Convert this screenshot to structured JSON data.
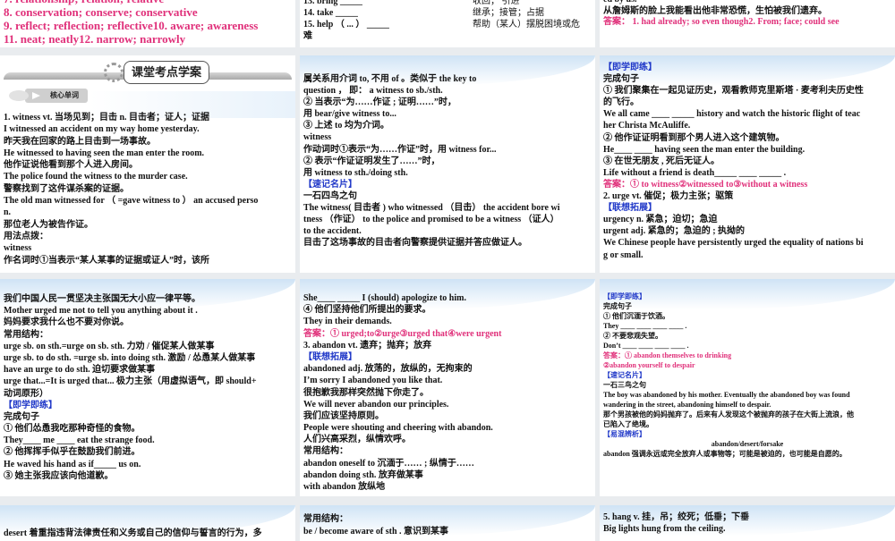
{
  "slides": [
    {
      "id": "top-left",
      "lines": [
        {
          "t": "7. relationship; relation; relative",
          "c": "pink"
        },
        {
          "t": "8. conservation; conserve; conservative",
          "c": "pink"
        },
        {
          "t": "9. reflect; reflection; reflective10. aware; awareness",
          "c": "pink"
        },
        {
          "t": "11. neat; neatly12. narrow; narrowly",
          "c": "pink"
        }
      ]
    },
    {
      "id": "top-middle",
      "lines": [
        {
          "t": "13. bring _____"
        },
        {
          "t": "14. take _____"
        },
        {
          "t": "15. help （ ... ）    _____"
        },
        {
          "t": "难"
        }
      ],
      "right_lines": [
        {
          "t": "收回；  引进"
        },
        {
          "t": "继承；接管；占据"
        },
        {
          "t": " 帮助（某人）摆脱困境或危"
        }
      ]
    },
    {
      "id": "top-right",
      "lines": [
        {
          "t": "ed by us."
        },
        {
          "t": "从詹姆斯的脸上我能看出他非常恐慌，生怕被我们遗弃。"
        },
        {
          "t": "答案： 1. had already; so even though2. From; face; could see",
          "c": "pink"
        }
      ]
    },
    {
      "id": "witness-core",
      "banner": "课堂考点学案",
      "tag": "核心单词",
      "lines": [
        {
          "t": "1. witness vt. 当场见到；目击 n. 目击者；证人；证据"
        },
        {
          "t": "I witnessed an accident on my way home yesterday."
        },
        {
          "t": "昨天我在回家的路上目击到一场事故。"
        },
        {
          "t": "He witnessed to having seen the man enter the room."
        },
        {
          "t": "他作证说他看到那个人进入房间。"
        },
        {
          "t": "The police found the witness to the murder case."
        },
        {
          "t": "警察找到了这件谋杀案的证据。"
        },
        {
          "t": "The old man  witnessed for （ =gave witness to ）   an accused perso"
        },
        {
          "t": "n."
        },
        {
          "t": "那位老人为被告作证。"
        },
        {
          "t": "用法点拨："
        },
        {
          "t": "witness"
        },
        {
          "t": "作名词时①当表示“某人某事的证据或证人”时，该所"
        }
      ]
    },
    {
      "id": "witness-usage",
      "lines": [
        {
          "t": "属关系用介词 to, 不用 of  。类似于 the key to"
        },
        {
          "t": "question ， 即：  a witness to sb./sth."
        },
        {
          "t": "② 当表示“为……作证 ; 证明……”时，"
        },
        {
          "t": "用 bear/give witness to..."
        },
        {
          "t": "③ 上述 to 均为介词。"
        },
        {
          "t": "witness"
        },
        {
          "t": "作动词时①表示“为……作证”时，用 witness for..."
        },
        {
          "t": "② 表示“作证证明发生了……”时，"
        },
        {
          "t": "用 witness to sth./doing sth."
        },
        {
          "t": "【速记名片】",
          "c": "blue"
        },
        {
          "t": "一石四鸟之句"
        },
        {
          "t": "The witness( 目击者 ) who witnessed （目击）   the accident bore wi"
        },
        {
          "t": "tness （作证）   to the police and promised to be a witness （证人）"
        },
        {
          "t": "to the accident."
        },
        {
          "t": "目击了这场事故的目击者向警察提供证据并答应做证人。"
        }
      ]
    },
    {
      "id": "witness-practice",
      "lines": [
        {
          "t": "【即学即练】",
          "c": "blue"
        },
        {
          "t": "完成句子"
        },
        {
          "t": "① 我们聚集在一起见证历史，观看教师克里斯塔 · 麦考利夫历史性"
        },
        {
          "t": "的飞行。"
        },
        {
          "t": "We all came ____ _____  history and watch the historic flight of teac"
        },
        {
          "t": "her Christa McAuliffe."
        },
        {
          "t": "② 他作证证明看到那个男人进入这个建筑物。"
        },
        {
          "t": "He____ ____  having seen the man enter the building."
        },
        {
          "t": "③ 在世无朋友 , 死后无证人。"
        },
        {
          "t": "Life without a friend is death_____ ____ _____ ."
        },
        {
          "t": "答案：① to witness②witnessed to③without a witness",
          "c": "pink"
        },
        {
          "t": "2. urge vt.  催促；极力主张；驱策"
        },
        {
          "t": "【联想拓展】",
          "c": "blue"
        },
        {
          "t": "urgency  n. 紧急；迫切；急迫"
        },
        {
          "t": "urgent  adj. 紧急的；急迫的 ; 执拗的"
        },
        {
          "t": "We Chinese people have persistently urged the equality of nations bi"
        },
        {
          "t": "g or small."
        }
      ]
    },
    {
      "id": "urge-structures",
      "lines": [
        {
          "t": "我们中国人民一贯坚决主张国无大小应一律平等。"
        },
        {
          "t": "Mother urged me not to tell you anything about it ."
        },
        {
          "t": "妈妈要求我什么也不要对你说。"
        },
        {
          "t": "常用结构："
        },
        {
          "t": "urge sb. on sth.=urge on sb. sth.  力劝 / 催促某人做某事"
        },
        {
          "t": "urge sb. to do sth. =urge sb. into doing sth. 激励 / 怂恿某人做某事"
        },
        {
          "t": "have an urge to do sth. 迫切要求做某事"
        },
        {
          "t": "urge that...=It is urged that... 极力主张（用虚拟语气，即 should+"
        },
        {
          "t": "动词原形）"
        },
        {
          "t": "【即学即练】",
          "c": "blue"
        },
        {
          "t": "完成句子"
        },
        {
          "t": "① 他们怂恿我吃那种奇怪的食物。"
        },
        {
          "t": "They____ me ____ eat the strange food."
        },
        {
          "t": "② 他挥挥手似乎在鼓励我们前进。"
        },
        {
          "t": "He waved his hand as if_____  us on."
        },
        {
          "t": "③ 她主张我应该向他道歉。"
        }
      ]
    },
    {
      "id": "abandon-expand",
      "lines": [
        {
          "t": "She____ _____  I (should) apologize to him."
        },
        {
          "t": "④ 他们坚持他们所提出的要求。"
        },
        {
          "t": "They   in their demands."
        },
        {
          "t": "答案：① urged;to②urge③urged that④were urgent",
          "c": "pink"
        },
        {
          "t": "3. abandon vt.  遗弃；抛弃；放弃"
        },
        {
          "t": "【联想拓展】",
          "c": "blue"
        },
        {
          "t": "abandoned adj.  放荡的，放纵的，无拘束的"
        },
        {
          "t": "I’m sorry I abandoned you like that."
        },
        {
          "t": "很抱歉我那样突然抛下你走了。"
        },
        {
          "t": "We will never abandon our principles."
        },
        {
          "t": "我们应该坚持原则。"
        },
        {
          "t": "People were shouting and cheering with abandon."
        },
        {
          "t": "人们兴高采烈，纵情欢呼。"
        },
        {
          "t": "常用结构："
        },
        {
          "t": "abandon oneself to 沉湎于…… ; 纵情于……"
        },
        {
          "t": "abandon doing sth. 放弃做某事"
        },
        {
          "t": "with abandon 放纵地"
        }
      ]
    },
    {
      "id": "abandon-practice",
      "lines": [
        {
          "t": "【即学即练】",
          "c": "blue"
        },
        {
          "t": "完成句子"
        },
        {
          "t": "① 他们沉湎于饮酒。"
        },
        {
          "t": "They ____ ____ ____ ____ ."
        },
        {
          "t": "② 不要悲观失望。"
        },
        {
          "t": "Don’t ____ ____ ____ ____ ."
        },
        {
          "t": "答案：① abandon themselves to drinking",
          "c": "pink"
        },
        {
          "t": "②abandon yourself to despair",
          "c": "pink"
        },
        {
          "t": "【速记名片】",
          "c": "blue"
        },
        {
          "t": "一石三鸟之句"
        },
        {
          "t": "The boy was abandoned by his mother. Eventually the abandoned boy was found"
        },
        {
          "t": "wandering in the street, abandoning himself to despair."
        },
        {
          "t": "那个男孩被他的妈妈抛弃了。后来有人发现这个被抛弃的孩子在大街上流浪，他"
        },
        {
          "t": "已陷入了绝境。"
        },
        {
          "t": "【易混辨析】",
          "c": "blue"
        },
        {
          "t": "abandon/desert/forsake",
          "c": "center"
        },
        {
          "t": "abandon  强调永远或完全放弃人或事物等；可能是被迫的，也可能是自愿的。"
        }
      ]
    },
    {
      "id": "desert-note",
      "lines": [
        {
          "t": "desert  着重指违背法律责任和义务或自己的信仰与誓言的行为，多"
        }
      ]
    },
    {
      "id": "aware-structures",
      "lines": [
        {
          "t": "常用结构："
        },
        {
          "t": "be  /  become aware of sth .  意识到某事"
        }
      ]
    },
    {
      "id": "hang",
      "lines": [
        {
          "t": "5. hang v. 挂，吊；绞死；低垂；下垂"
        },
        {
          "t": "Big lights hung from the ceiling."
        }
      ]
    }
  ]
}
